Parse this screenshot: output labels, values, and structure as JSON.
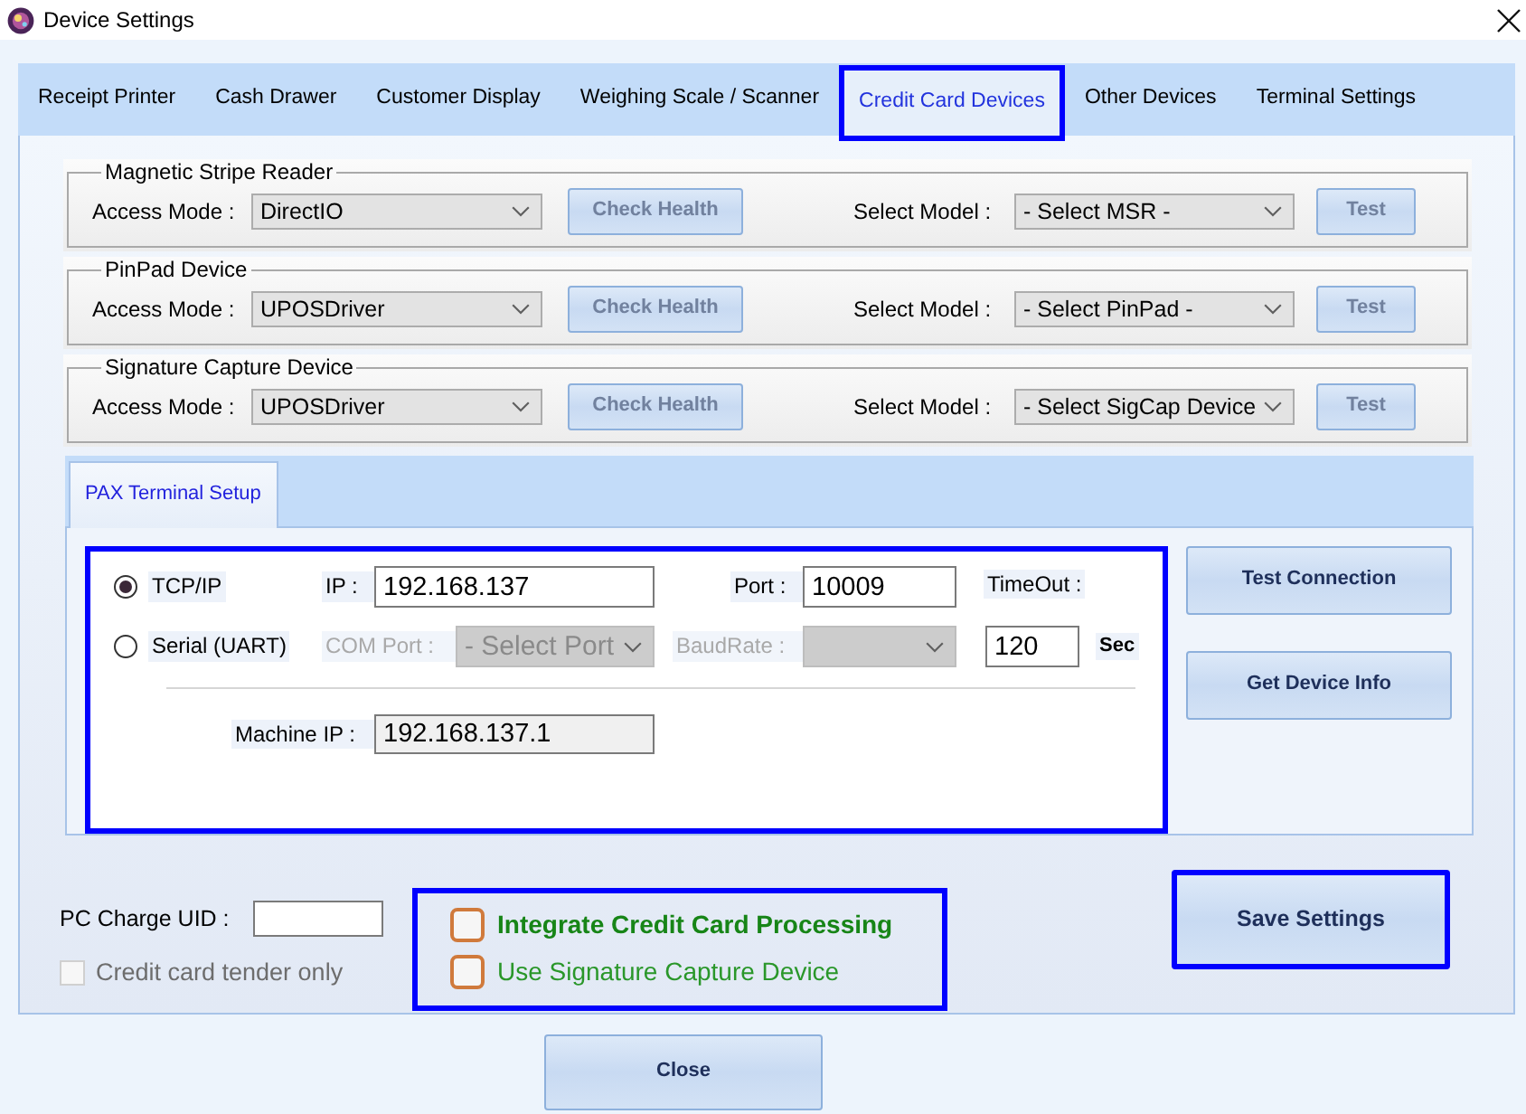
{
  "window": {
    "title": "Device Settings"
  },
  "tabs": [
    {
      "label": "Receipt Printer",
      "selected": false
    },
    {
      "label": "Cash Drawer",
      "selected": false
    },
    {
      "label": "Customer Display",
      "selected": false
    },
    {
      "label": "Weighing Scale / Scanner",
      "selected": false
    },
    {
      "label": "Credit Card Devices",
      "selected": true
    },
    {
      "label": "Other Devices",
      "selected": false
    },
    {
      "label": "Terminal Settings",
      "selected": false
    }
  ],
  "device_groups": [
    {
      "title": "Magnetic Stripe Reader",
      "access_mode_label": "Access Mode :",
      "access_mode": "DirectIO",
      "check_health": {
        "label": "Check Health",
        "disabled": true
      },
      "select_model_label": "Select Model :",
      "model": "- Select MSR -",
      "test": {
        "label": "Test",
        "disabled": true
      }
    },
    {
      "title": "PinPad Device",
      "access_mode_label": "Access Mode :",
      "access_mode": "UPOSDriver",
      "check_health": {
        "label": "Check Health",
        "disabled": true
      },
      "select_model_label": "Select Model :",
      "model": "- Select PinPad -",
      "test": {
        "label": "Test",
        "disabled": true
      }
    },
    {
      "title": "Signature Capture Device",
      "access_mode_label": "Access Mode :",
      "access_mode": "UPOSDriver",
      "check_health": {
        "label": "Check Health",
        "disabled": true
      },
      "select_model_label": "Select Model :",
      "model": "- Select SigCap Device",
      "test": {
        "label": "Test",
        "disabled": true
      }
    }
  ],
  "pax_tabs": [
    {
      "label": "PAX Terminal Setup",
      "selected": true
    }
  ],
  "pax_setup": {
    "highlighted": true,
    "connection_options": [
      {
        "label": "TCP/IP",
        "selected": true
      },
      {
        "label": "Serial (UART)",
        "selected": false
      }
    ],
    "ip": {
      "label": "IP :",
      "value": "192.168.137"
    },
    "port": {
      "label": "Port :",
      "value": "10009"
    },
    "timeout": {
      "label": "TimeOut :",
      "value": "120",
      "unit": "Sec"
    },
    "com_port": {
      "label": "COM Port :",
      "value": "- Select Port",
      "disabled": true
    },
    "baud_rate": {
      "label": "BaudRate :",
      "disabled": true
    },
    "machine_ip": {
      "label": "Machine IP :",
      "value": "192.168.137.1",
      "readonly": true
    }
  },
  "pax_buttons": [
    {
      "label": "Test Connection"
    },
    {
      "label": "Get Device Info"
    }
  ],
  "pc_charge_uid": {
    "label": "PC Charge UID :"
  },
  "credit_card_tender_only": {
    "label": "Credit card tender only",
    "checked": false,
    "disabled": true
  },
  "integration_options": {
    "highlighted": true,
    "items": [
      {
        "label": "Integrate Credit Card Processing",
        "checked": false,
        "emphasized": true
      },
      {
        "label": "Use Signature Capture Device",
        "checked": false,
        "emphasized": false
      }
    ]
  },
  "save_button": {
    "label": "Save Settings",
    "highlighted": true
  },
  "close_button": {
    "label": "Close"
  }
}
